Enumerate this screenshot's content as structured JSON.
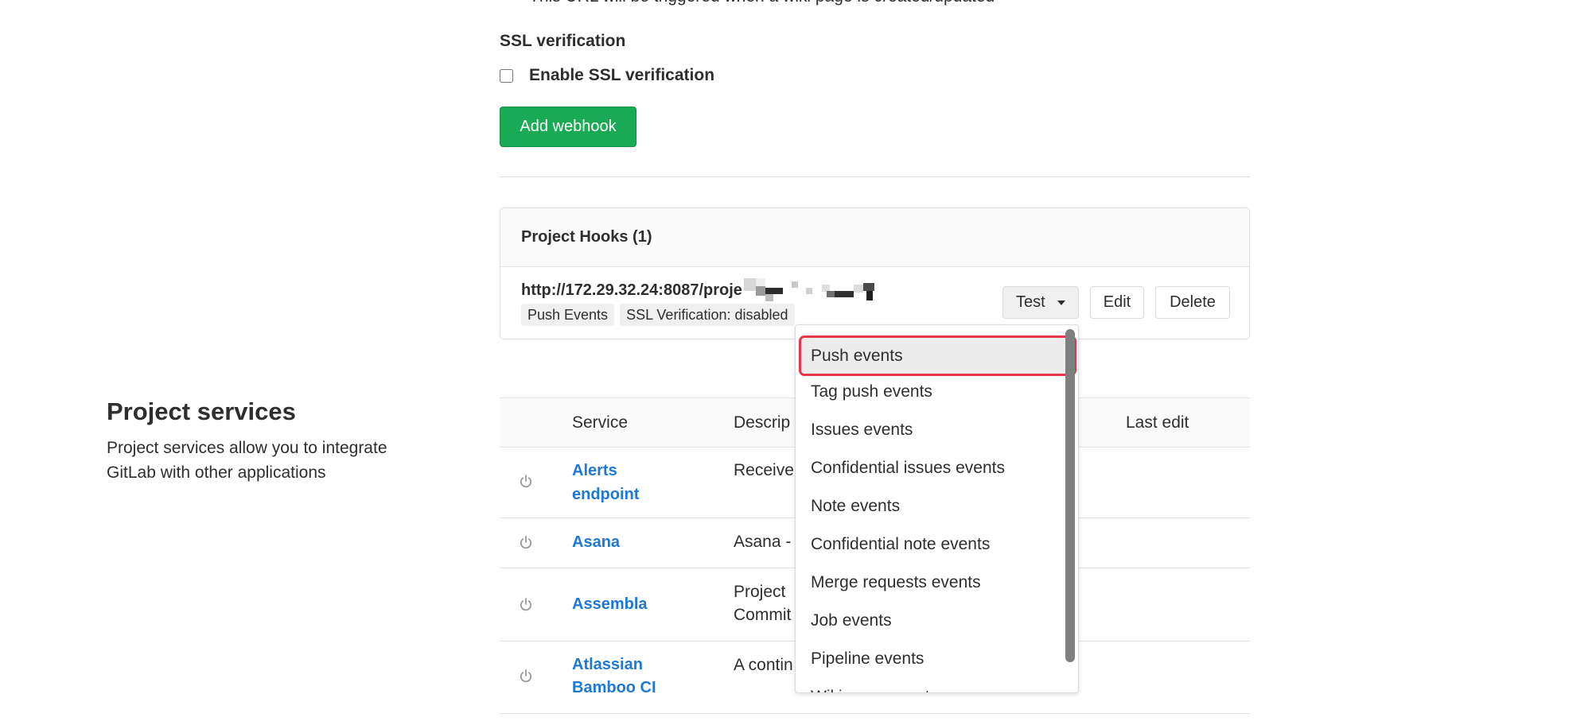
{
  "theme": {
    "accent_green": "#1aaa55",
    "link_blue": "#1f78d1",
    "highlight_red": "#e5374b"
  },
  "webhook_form": {
    "wiki_url_hint": "This URL will be triggered when a wiki page is created/updated",
    "ssl_title": "SSL verification",
    "ssl_checkbox_label": "Enable SSL verification",
    "ssl_verification_enabled": false,
    "add_button_label": "Add webhook"
  },
  "hooks": {
    "title": "Project Hooks (1)",
    "items": [
      {
        "url": "http://172.29.32.24:8087/proje",
        "badges": [
          "Push Events",
          "SSL Verification: disabled"
        ],
        "test_label": "Test",
        "edit_label": "Edit",
        "delete_label": "Delete"
      }
    ]
  },
  "test_menu": {
    "selected_index": 0,
    "items": [
      "Push events",
      "Tag push events",
      "Issues events",
      "Confidential issues events",
      "Note events",
      "Confidential note events",
      "Merge requests events",
      "Job events",
      "Pipeline events",
      "Wiki page events"
    ]
  },
  "services": {
    "title": "Project services",
    "description_lines": [
      "Project services allow you to integrate",
      "GitLab with other applications"
    ],
    "columns": [
      "",
      "Service",
      "Descrip",
      "Last edit"
    ],
    "rows": [
      {
        "name": "Alerts endpoint",
        "description": [
          "Receive"
        ],
        "icon": "power-icon"
      },
      {
        "name": "Asana",
        "description": [
          "Asana -"
        ],
        "icon": "power-icon"
      },
      {
        "name": "Assembla",
        "description": [
          "Project",
          "Commit"
        ],
        "icon": "power-icon"
      },
      {
        "name": "Atlassian Bamboo CI",
        "description": [
          "A contin"
        ],
        "icon": "power-icon"
      }
    ]
  }
}
